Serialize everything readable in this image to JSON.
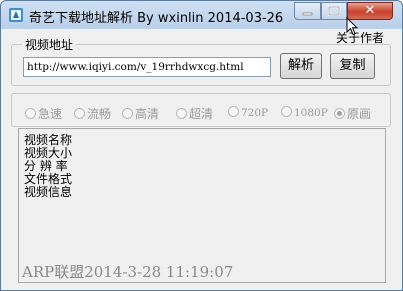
{
  "window": {
    "title": "奇艺下载地址解析   By wxinlin  2014-03-26",
    "minimize_label": "",
    "maximize_label": "",
    "close_label": "✕"
  },
  "header": {
    "about_label": "关于作者"
  },
  "url_group": {
    "legend": "视频地址",
    "url_value": "http://www.iqiyi.com/v_19rrhdwxcg.html",
    "parse_button": "解析",
    "copy_button": "复制"
  },
  "quality_options": [
    {
      "label": "急速",
      "selected": false
    },
    {
      "label": "流畅",
      "selected": false
    },
    {
      "label": "高清",
      "selected": false
    },
    {
      "label": "超清",
      "selected": false
    },
    {
      "label": "720P",
      "selected": false
    },
    {
      "label": "1080P",
      "selected": false
    },
    {
      "label": "原画",
      "selected": true
    }
  ],
  "info_lines": [
    "视频名称",
    "视频大小",
    "分 辨 率",
    "文件格式",
    "视频信息"
  ],
  "watermark": "ARP联盟2014-3-28 11:19:07",
  "colors": {
    "frame_border": "#5c7ba0",
    "close_button": "#c8412b",
    "disabled_text": "#9a9a9a"
  },
  "icons": [
    "app-icon",
    "close-icon",
    "minimize-icon",
    "maximize-icon",
    "cursor-icon"
  ]
}
